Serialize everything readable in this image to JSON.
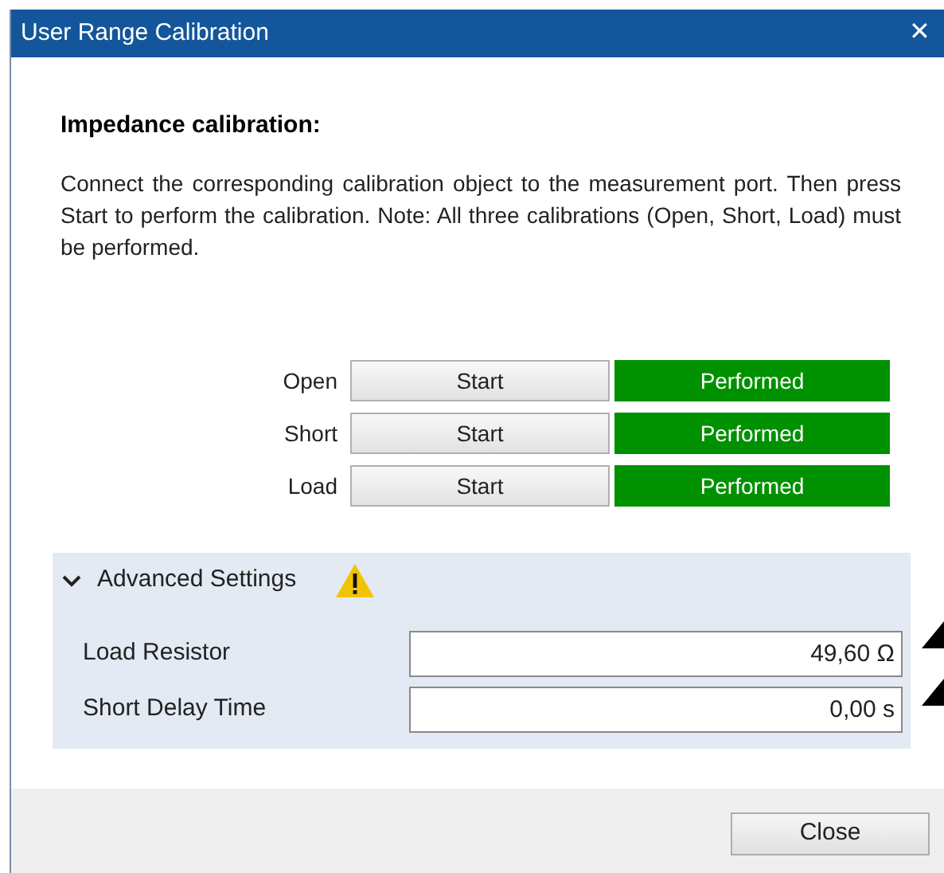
{
  "window": {
    "title": "User Range Calibration",
    "close": "✕"
  },
  "heading": "Impedance calibration:",
  "instructions": "Connect the corresponding calibration object to the measurement port. Then press Start to perform the calibration. Note: All three calibrations (Open, Short, Load) must be performed.",
  "calibrations": [
    {
      "label": "Open",
      "button": "Start",
      "status": "Performed"
    },
    {
      "label": "Short",
      "button": "Start",
      "status": "Performed"
    },
    {
      "label": "Load",
      "button": "Start",
      "status": "Performed"
    }
  ],
  "advanced": {
    "title": "Advanced Settings",
    "expanded": true,
    "warning": true,
    "fields": [
      {
        "label": "Load Resistor",
        "value": "49,60 Ω"
      },
      {
        "label": "Short Delay Time",
        "value": "0,00 s"
      }
    ]
  },
  "buttons": [
    "Close"
  ]
}
